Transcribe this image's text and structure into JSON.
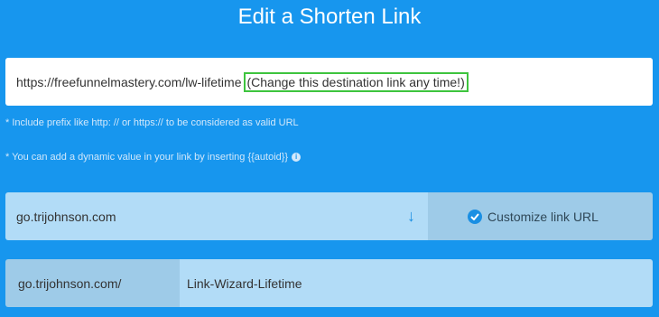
{
  "header": {
    "title": "Edit a Shorten Link"
  },
  "destination": {
    "url": "https://freefunnelmastery.com/lw-lifetime",
    "annotation": "(Change this destination link any time!)"
  },
  "hints": {
    "prefix": "* Include prefix like http: // or https:// to be considered as valid URL",
    "dynamic": "* You can add a dynamic value in your link by inserting {{autoid}}"
  },
  "domain": {
    "selected": "go.trijohnson.com",
    "customize_label": "Customize link URL"
  },
  "slug": {
    "prefix": "go.trijohnson.com/",
    "value": "Link-Wizard-Lifetime"
  },
  "icons": {
    "dropdown": "arrow-down-icon",
    "customize": "check-circle-icon",
    "hint": "info-icon"
  },
  "colors": {
    "background": "#1796ee",
    "highlight_border": "#3ec43e",
    "accent": "#1a8fe3"
  }
}
